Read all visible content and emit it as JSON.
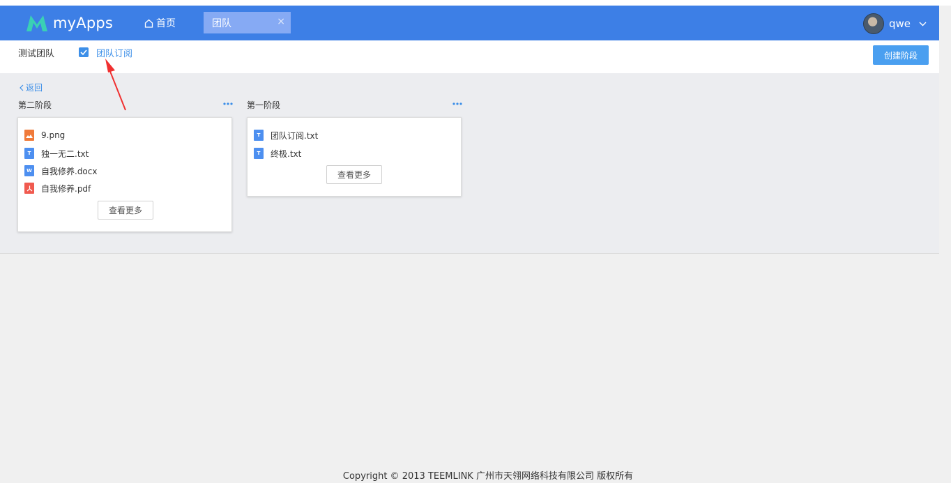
{
  "app": {
    "logo_text": "myApps"
  },
  "nav": {
    "home_label": "首页",
    "active_tab": "团队",
    "tab_close": "×"
  },
  "user": {
    "name": "qwe"
  },
  "subbar": {
    "team_name": "测试团队",
    "subscribe_label": "团队订阅",
    "subscribed": true,
    "create_button": "创建阶段"
  },
  "content": {
    "back_label": "返回",
    "stages": [
      {
        "title": "第二阶段",
        "files": [
          {
            "name": "9.png",
            "icon": "image-file-icon",
            "color": "#f07a3a"
          },
          {
            "name": "独一无二.txt",
            "icon": "text-file-icon",
            "color": "#4d8ff0"
          },
          {
            "name": "自我修养.docx",
            "icon": "word-file-icon",
            "color": "#4d8ff0"
          },
          {
            "name": "自我修养.pdf",
            "icon": "pdf-file-icon",
            "color": "#f05a4f"
          }
        ],
        "more_label": "查看更多"
      },
      {
        "title": "第一阶段",
        "files": [
          {
            "name": "团队订阅.txt",
            "icon": "text-file-icon",
            "color": "#4d8ff0"
          },
          {
            "name": "终极.txt",
            "icon": "text-file-icon",
            "color": "#4d8ff0"
          }
        ],
        "more_label": "查看更多"
      }
    ]
  },
  "footer": {
    "copyright": "Copyright © 2013 TEEMLINK 广州市天翎网络科技有限公司 版权所有"
  },
  "colors": {
    "navbar": "#3d7fe6",
    "accent": "#3d8fe8",
    "tab": "#86aaf4",
    "annotation_arrow": "#f03030"
  }
}
